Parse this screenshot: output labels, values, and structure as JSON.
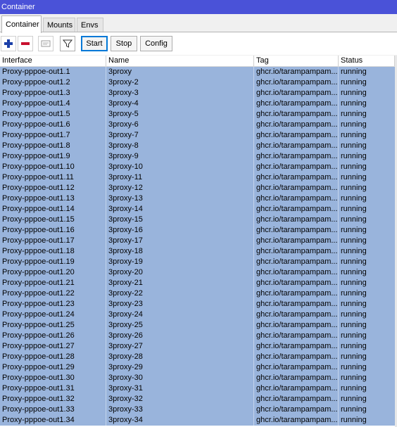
{
  "window": {
    "title": "Container"
  },
  "tabs": [
    {
      "label": "Container",
      "active": true
    },
    {
      "label": "Mounts",
      "active": false
    },
    {
      "label": "Envs",
      "active": false
    }
  ],
  "toolbar": {
    "add_icon": "plus-icon",
    "remove_icon": "minus-icon",
    "comment_icon": "comment-icon",
    "filter_icon": "filter-icon",
    "start_label": "Start",
    "stop_label": "Stop",
    "config_label": "Config"
  },
  "table": {
    "columns": [
      "Interface",
      "Name",
      "Tag",
      "Status"
    ],
    "rows": [
      {
        "interface": "Proxy-pppoe-out1.1",
        "name": "3proxy",
        "tag": "ghcr.io/tarampampam...",
        "status": "running"
      },
      {
        "interface": "Proxy-pppoe-out1.2",
        "name": "3proxy-2",
        "tag": "ghcr.io/tarampampam...",
        "status": "running"
      },
      {
        "interface": "Proxy-pppoe-out1.3",
        "name": "3proxy-3",
        "tag": "ghcr.io/tarampampam...",
        "status": "running"
      },
      {
        "interface": "Proxy-pppoe-out1.4",
        "name": "3proxy-4",
        "tag": "ghcr.io/tarampampam...",
        "status": "running"
      },
      {
        "interface": "Proxy-pppoe-out1.5",
        "name": "3proxy-5",
        "tag": "ghcr.io/tarampampam...",
        "status": "running"
      },
      {
        "interface": "Proxy-pppoe-out1.6",
        "name": "3proxy-6",
        "tag": "ghcr.io/tarampampam...",
        "status": "running"
      },
      {
        "interface": "Proxy-pppoe-out1.7",
        "name": "3proxy-7",
        "tag": "ghcr.io/tarampampam...",
        "status": "running"
      },
      {
        "interface": "Proxy-pppoe-out1.8",
        "name": "3proxy-8",
        "tag": "ghcr.io/tarampampam...",
        "status": "running"
      },
      {
        "interface": "Proxy-pppoe-out1.9",
        "name": "3proxy-9",
        "tag": "ghcr.io/tarampampam...",
        "status": "running"
      },
      {
        "interface": "Proxy-pppoe-out1.10",
        "name": "3proxy-10",
        "tag": "ghcr.io/tarampampam...",
        "status": "running"
      },
      {
        "interface": "Proxy-pppoe-out1.11",
        "name": "3proxy-11",
        "tag": "ghcr.io/tarampampam...",
        "status": "running"
      },
      {
        "interface": "Proxy-pppoe-out1.12",
        "name": "3proxy-12",
        "tag": "ghcr.io/tarampampam...",
        "status": "running"
      },
      {
        "interface": "Proxy-pppoe-out1.13",
        "name": "3proxy-13",
        "tag": "ghcr.io/tarampampam...",
        "status": "running"
      },
      {
        "interface": "Proxy-pppoe-out1.14",
        "name": "3proxy-14",
        "tag": "ghcr.io/tarampampam...",
        "status": "running"
      },
      {
        "interface": "Proxy-pppoe-out1.15",
        "name": "3proxy-15",
        "tag": "ghcr.io/tarampampam...",
        "status": "running"
      },
      {
        "interface": "Proxy-pppoe-out1.16",
        "name": "3proxy-16",
        "tag": "ghcr.io/tarampampam...",
        "status": "running"
      },
      {
        "interface": "Proxy-pppoe-out1.17",
        "name": "3proxy-17",
        "tag": "ghcr.io/tarampampam...",
        "status": "running"
      },
      {
        "interface": "Proxy-pppoe-out1.18",
        "name": "3proxy-18",
        "tag": "ghcr.io/tarampampam...",
        "status": "running"
      },
      {
        "interface": "Proxy-pppoe-out1.19",
        "name": "3proxy-19",
        "tag": "ghcr.io/tarampampam...",
        "status": "running"
      },
      {
        "interface": "Proxy-pppoe-out1.20",
        "name": "3proxy-20",
        "tag": "ghcr.io/tarampampam...",
        "status": "running"
      },
      {
        "interface": "Proxy-pppoe-out1.21",
        "name": "3proxy-21",
        "tag": "ghcr.io/tarampampam...",
        "status": "running"
      },
      {
        "interface": "Proxy-pppoe-out1.22",
        "name": "3proxy-22",
        "tag": "ghcr.io/tarampampam...",
        "status": "running"
      },
      {
        "interface": "Proxy-pppoe-out1.23",
        "name": "3proxy-23",
        "tag": "ghcr.io/tarampampam...",
        "status": "running"
      },
      {
        "interface": "Proxy-pppoe-out1.24",
        "name": "3proxy-24",
        "tag": "ghcr.io/tarampampam...",
        "status": "running"
      },
      {
        "interface": "Proxy-pppoe-out1.25",
        "name": "3proxy-25",
        "tag": "ghcr.io/tarampampam...",
        "status": "running"
      },
      {
        "interface": "Proxy-pppoe-out1.26",
        "name": "3proxy-26",
        "tag": "ghcr.io/tarampampam...",
        "status": "running"
      },
      {
        "interface": "Proxy-pppoe-out1.27",
        "name": "3proxy-27",
        "tag": "ghcr.io/tarampampam...",
        "status": "running"
      },
      {
        "interface": "Proxy-pppoe-out1.28",
        "name": "3proxy-28",
        "tag": "ghcr.io/tarampampam...",
        "status": "running"
      },
      {
        "interface": "Proxy-pppoe-out1.29",
        "name": "3proxy-29",
        "tag": "ghcr.io/tarampampam...",
        "status": "running"
      },
      {
        "interface": "Proxy-pppoe-out1.30",
        "name": "3proxy-30",
        "tag": "ghcr.io/tarampampam...",
        "status": "running"
      },
      {
        "interface": "Proxy-pppoe-out1.31",
        "name": "3proxy-31",
        "tag": "ghcr.io/tarampampam...",
        "status": "running"
      },
      {
        "interface": "Proxy-pppoe-out1.32",
        "name": "3proxy-32",
        "tag": "ghcr.io/tarampampam...",
        "status": "running"
      },
      {
        "interface": "Proxy-pppoe-out1.33",
        "name": "3proxy-33",
        "tag": "ghcr.io/tarampampam...",
        "status": "running"
      },
      {
        "interface": "Proxy-pppoe-out1.34",
        "name": "3proxy-34",
        "tag": "ghcr.io/tarampampam...",
        "status": "running"
      }
    ]
  },
  "colors": {
    "titlebar": "#4a52d8",
    "selected_row": "#99b4dc",
    "add_icon": "#1b3fa8",
    "remove_icon": "#c8102e"
  }
}
